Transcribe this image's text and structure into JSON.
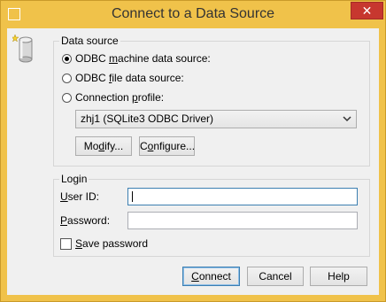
{
  "window": {
    "title": "Connect to a Data Source",
    "close_glyph": "✕"
  },
  "data_source": {
    "legend": "Data source",
    "options": [
      {
        "label_pre": "ODBC ",
        "label_ul": "m",
        "label_post": "achine data source:",
        "checked": true
      },
      {
        "label_pre": "ODBC ",
        "label_ul": "f",
        "label_post": "ile data source:",
        "checked": false
      },
      {
        "label_pre": "Connection ",
        "label_ul": "p",
        "label_post": "rofile:",
        "checked": false
      }
    ],
    "profile_selected": "zhj1 (SQLite3 ODBC Driver)",
    "modify": {
      "pre": "Mo",
      "ul": "d",
      "post": "ify..."
    },
    "configure": {
      "pre": "C",
      "ul": "o",
      "post": "nfigure..."
    }
  },
  "login": {
    "legend": "Login",
    "user_id": {
      "pre": "",
      "ul": "U",
      "post": "ser ID:",
      "value": ""
    },
    "password": {
      "pre": "",
      "ul": "P",
      "post": "assword:",
      "value": ""
    },
    "save_password": {
      "pre": "",
      "ul": "S",
      "post": "ave password",
      "checked": false
    }
  },
  "buttons": {
    "connect": {
      "pre": "",
      "ul": "C",
      "post": "onnect"
    },
    "cancel": "Cancel",
    "help": "Help"
  },
  "colors": {
    "titlebar": "#f0c24a",
    "close_button": "#c7372f",
    "client_bg": "#f0f0f0",
    "focus_border": "#3c7fb1"
  },
  "icons": {
    "app": "window-app-icon",
    "close": "close-icon",
    "data_source": "database-icon",
    "dropdown": "chevron-down-icon"
  }
}
